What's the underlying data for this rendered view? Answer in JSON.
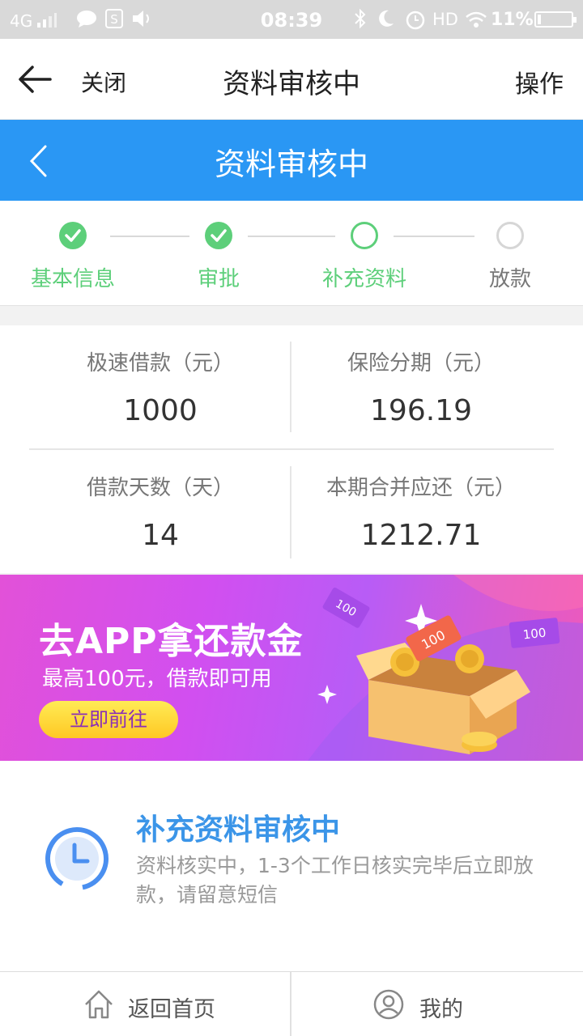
{
  "status_bar": {
    "network": "4G",
    "time": "08:39",
    "hd": "HD",
    "battery_text": "11%",
    "battery_level": 0.11
  },
  "app_header": {
    "close_label": "关闭",
    "title": "资料审核中",
    "operate_label": "操作"
  },
  "blue_header": {
    "title": "资料审核中"
  },
  "steps": [
    {
      "label": "基本信息",
      "state": "done"
    },
    {
      "label": "审批",
      "state": "done"
    },
    {
      "label": "补充资料",
      "state": "current"
    },
    {
      "label": "放款",
      "state": "pending"
    }
  ],
  "info": {
    "loan_amount_label": "极速借款（元）",
    "loan_amount_value": "1000",
    "insurance_label": "保险分期（元）",
    "insurance_value": "196.19",
    "days_label": "借款天数（天）",
    "days_value": "14",
    "repay_label": "本期合并应还（元）",
    "repay_value": "1212.71"
  },
  "banner": {
    "title": "去APP拿还款金",
    "subtitle": "最高100元，借款即可用",
    "button_label": "立即前往",
    "ticket_label_1": "100",
    "ticket_label_2": "100",
    "ticket_label_3": "100"
  },
  "review": {
    "title": "补充资料审核中",
    "description": "资料核实中，1-3个工作日核实完毕后立即放款，请留意短信"
  },
  "bottom_nav": {
    "home_label": "返回首页",
    "mine_label": "我的"
  },
  "colors": {
    "primary_blue": "#2a97f4",
    "step_green": "#5dcf7a",
    "review_blue": "#3b95e8"
  }
}
